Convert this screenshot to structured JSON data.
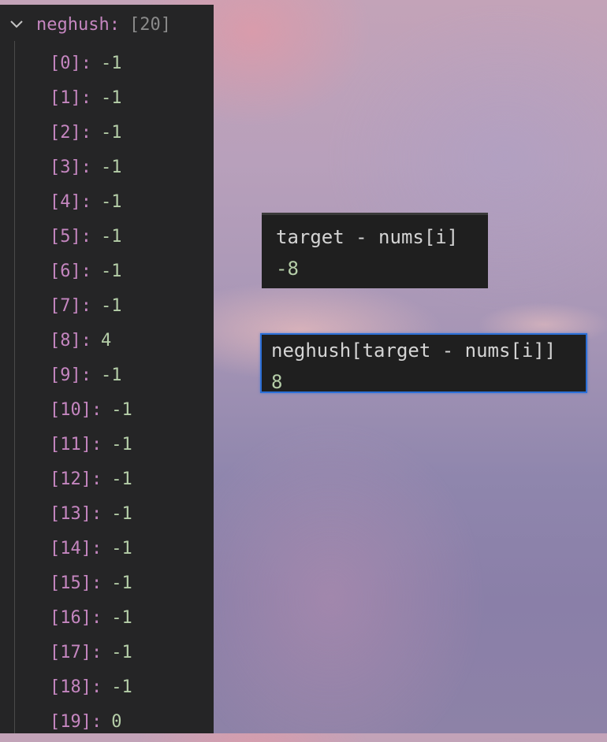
{
  "variable": {
    "name": "neghush",
    "separator": ":",
    "meta": "[20]",
    "expanded_icon": "chevron-down-icon"
  },
  "elements": [
    {
      "index": "[0]:",
      "value": "-1"
    },
    {
      "index": "[1]:",
      "value": "-1"
    },
    {
      "index": "[2]:",
      "value": "-1"
    },
    {
      "index": "[3]:",
      "value": "-1"
    },
    {
      "index": "[4]:",
      "value": "-1"
    },
    {
      "index": "[5]:",
      "value": "-1"
    },
    {
      "index": "[6]:",
      "value": "-1"
    },
    {
      "index": "[7]:",
      "value": "-1"
    },
    {
      "index": "[8]:",
      "value": "4"
    },
    {
      "index": "[9]:",
      "value": "-1"
    },
    {
      "index": "[10]:",
      "value": "-1"
    },
    {
      "index": "[11]:",
      "value": "-1"
    },
    {
      "index": "[12]:",
      "value": "-1"
    },
    {
      "index": "[13]:",
      "value": "-1"
    },
    {
      "index": "[14]:",
      "value": "-1"
    },
    {
      "index": "[15]:",
      "value": "-1"
    },
    {
      "index": "[16]:",
      "value": "-1"
    },
    {
      "index": "[17]:",
      "value": "-1"
    },
    {
      "index": "[18]:",
      "value": "-1"
    },
    {
      "index": "[19]:",
      "value": "0"
    }
  ],
  "hovers": [
    {
      "expression": "target - nums[i]",
      "result": "-8"
    },
    {
      "expression": "neghush[target - nums[i]]",
      "result": "8"
    }
  ],
  "colors": {
    "panel_bg": "#252526",
    "name": "#c586c0",
    "number": "#b5cea8",
    "hover_border_active": "#2b6fd6"
  }
}
